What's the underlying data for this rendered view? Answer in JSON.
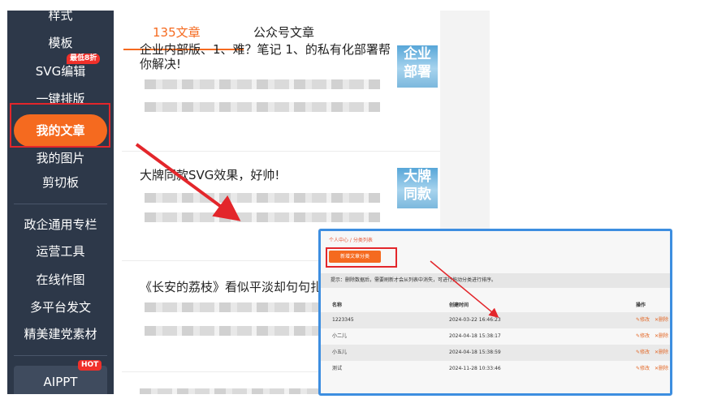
{
  "sidebar": {
    "items": [
      "样式",
      "模板",
      "SVG编辑",
      "一键排版",
      "我的文章",
      "我的图片",
      "剪切板",
      "政企通用专栏",
      "运营工具",
      "在线作图",
      "多平台发文",
      "精美建党素材",
      "AIPPT"
    ],
    "svg_badge": "最低8折",
    "aippt_badge": "HOT"
  },
  "tabs": [
    "135文章",
    "公众号文章"
  ],
  "articles": [
    {
      "title_line1": "企业内部版、1、难？笔记 1、的私有化部署帮",
      "title_line2": "你解决!",
      "thumb_text": "企业部署"
    },
    {
      "title_line1": "大牌同款SVG效果，好帅!",
      "title_line2": "",
      "thumb_text": "大牌同款"
    },
    {
      "title_line1": "《长安的荔枝》看似平淡却句句扎",
      "title_line2": "",
      "thumb_text": ""
    }
  ],
  "popup": {
    "breadcrumb": "个人中心 / 分类列表",
    "new_button": "新增文章分类",
    "tip": "提示：删除数据后，需要刷新才会从列表中消失，可进行拖动分类进行排序。",
    "headers": [
      "名称",
      "创建时间",
      "操作"
    ],
    "rows": [
      {
        "name": "1223345",
        "time": "2024-03-22 16:46:23"
      },
      {
        "name": "小二儿",
        "time": "2024-04-18 15:38:17"
      },
      {
        "name": "小五儿",
        "time": "2024-04-18 15:38:59"
      },
      {
        "name": "测试",
        "time": "2024-11-28 10:33:46"
      }
    ],
    "edit_label": "修改",
    "delete_label": "删除"
  },
  "colors": {
    "sidebar_bg": "#2d3849",
    "accent": "#f56a1f",
    "highlight_red": "#e3262b",
    "popup_border": "#3d8ee0"
  }
}
